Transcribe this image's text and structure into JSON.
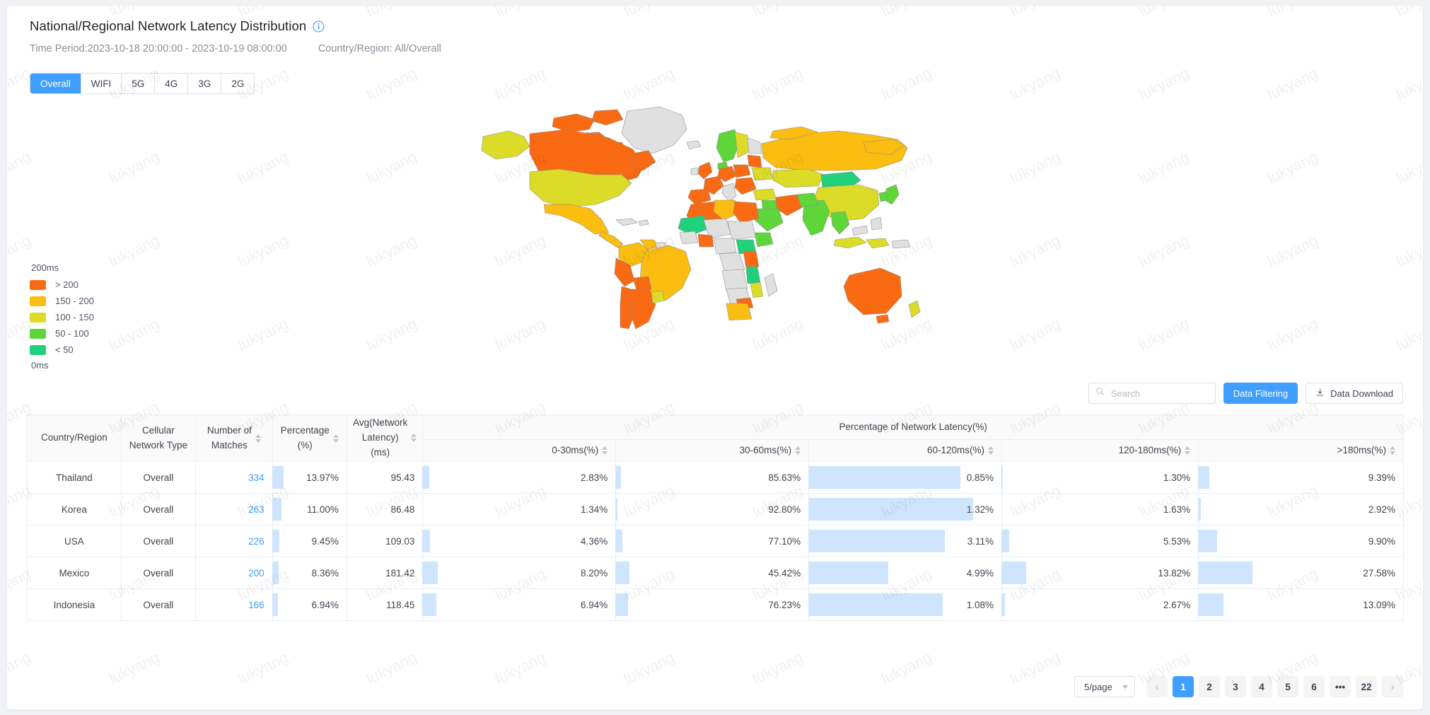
{
  "header": {
    "title": "National/Regional Network Latency Distribution",
    "info_icon": "info-circle-icon",
    "time_period": "Time Period:2023-10-18 20:00:00 - 2023-10-19 08:00:00",
    "country_region": "Country/Region: All/Overall"
  },
  "tabs": [
    {
      "label": "Overall",
      "active": true
    },
    {
      "label": "WIFI",
      "active": false
    },
    {
      "label": "5G",
      "active": false
    },
    {
      "label": "4G",
      "active": false
    },
    {
      "label": "3G",
      "active": false
    },
    {
      "label": "2G",
      "active": false
    }
  ],
  "legend": {
    "top_label": "200ms",
    "bottom_label": "0ms",
    "items": [
      {
        "label": "> 200",
        "color": "#f96a12"
      },
      {
        "label": "150 - 200",
        "color": "#fbbd10"
      },
      {
        "label": "100 - 150",
        "color": "#dcdc28"
      },
      {
        "label": "50 - 100",
        "color": "#5ed63a"
      },
      {
        "label": "< 50",
        "color": "#21d07a"
      }
    ]
  },
  "toolbar": {
    "search_placeholder": "Search",
    "search_value": "",
    "search_icon": "magnifier-icon",
    "filter_label": "Data Filtering",
    "download_label": "Data Download",
    "download_icon": "download-icon"
  },
  "table": {
    "group_header": "Percentage of Network Latency(%)",
    "columns": [
      {
        "label": "Country/Region",
        "sortable": false,
        "align": "center"
      },
      {
        "label": "Cellular\nNetwork Type",
        "sortable": false,
        "align": "center"
      },
      {
        "label": "Number of\nMatches",
        "sortable": true,
        "align": "center"
      },
      {
        "label": "Percentage\n(%)",
        "sortable": true,
        "align": "center"
      },
      {
        "label": "Avg(Network\nLatency)\n(ms)",
        "sortable": true,
        "align": "center"
      },
      {
        "label": "0-30ms(%)",
        "sortable": true,
        "align": "right"
      },
      {
        "label": "30-60ms(%)",
        "sortable": true,
        "align": "right"
      },
      {
        "label": "60-120ms(%)",
        "sortable": true,
        "align": "right"
      },
      {
        "label": "120-180ms(%)",
        "sortable": true,
        "align": "right"
      },
      {
        "label": ">180ms(%)",
        "sortable": true,
        "align": "right"
      }
    ],
    "rows": [
      {
        "country": "Thailand",
        "network_type": "Overall",
        "matches": "334",
        "matches_bar": 14,
        "percentage": "13.97%",
        "avg_latency": "95.43",
        "avg_bar": 8,
        "b0_30": "2.83%",
        "b0_30_bar": 3,
        "b30_60": "85.63%",
        "b30_60_bar": 86,
        "b60_120": "0.85%",
        "b60_120_bar": 1,
        "b120_180": "1.30%",
        "b120_180_bar": 13,
        "b180": "9.39%"
      },
      {
        "country": "Korea",
        "network_type": "Overall",
        "matches": "263",
        "matches_bar": 11,
        "percentage": "11.00%",
        "avg_latency": "86.48",
        "avg_bar": 0,
        "b0_30": "1.34%",
        "b0_30_bar": 1,
        "b30_60": "92.80%",
        "b30_60_bar": 93,
        "b60_120": "1.32%",
        "b60_120_bar": 0,
        "b120_180": "1.63%",
        "b120_180_bar": 3,
        "b180": "2.92%"
      },
      {
        "country": "USA",
        "network_type": "Overall",
        "matches": "226",
        "matches_bar": 9,
        "percentage": "9.45%",
        "avg_latency": "109.03",
        "avg_bar": 9,
        "b0_30": "4.36%",
        "b0_30_bar": 4,
        "b30_60": "77.10%",
        "b30_60_bar": 77,
        "b60_120": "3.11%",
        "b60_120_bar": 9,
        "b120_180": "5.53%",
        "b120_180_bar": 22,
        "b180": "9.90%"
      },
      {
        "country": "Mexico",
        "network_type": "Overall",
        "matches": "200",
        "matches_bar": 8,
        "percentage": "8.36%",
        "avg_latency": "181.42",
        "avg_bar": 18,
        "b0_30": "8.20%",
        "b0_30_bar": 8,
        "b30_60": "45.42%",
        "b30_60_bar": 45,
        "b60_120": "4.99%",
        "b60_120_bar": 29,
        "b120_180": "13.82%",
        "b120_180_bar": 64,
        "b180": "27.58%"
      },
      {
        "country": "Indonesia",
        "network_type": "Overall",
        "matches": "166",
        "matches_bar": 7,
        "percentage": "6.94%",
        "avg_latency": "118.45",
        "avg_bar": 16,
        "b0_30": "6.94%",
        "b0_30_bar": 7,
        "b30_60": "76.23%",
        "b30_60_bar": 76,
        "b60_120": "1.08%",
        "b60_120_bar": 4,
        "b120_180": "2.67%",
        "b120_180_bar": 30,
        "b180": "13.09%"
      }
    ]
  },
  "pagination": {
    "page_size": "5/page",
    "items": [
      {
        "label": "‹",
        "type": "prev"
      },
      {
        "label": "1",
        "type": "page",
        "active": true
      },
      {
        "label": "2",
        "type": "page"
      },
      {
        "label": "3",
        "type": "page"
      },
      {
        "label": "4",
        "type": "page"
      },
      {
        "label": "5",
        "type": "page"
      },
      {
        "label": "6",
        "type": "page"
      },
      {
        "label": "•••",
        "type": "ellipsis"
      },
      {
        "label": "22",
        "type": "page"
      },
      {
        "label": "›",
        "type": "next"
      }
    ]
  },
  "watermark": {
    "text": "lukyang"
  },
  "colors": {
    "accent": "#409eff",
    "bar": "#cfe4fd",
    "link": "#409eff",
    "map_none": "#e0e0e0"
  }
}
